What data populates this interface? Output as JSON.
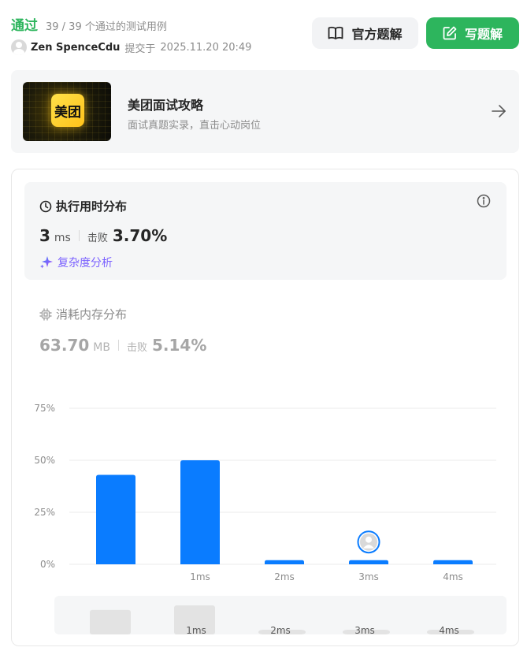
{
  "header": {
    "status": "通过",
    "case_count": "39 / 39 个通过的测试用例",
    "username": "Zen SpenceCdu",
    "submit_label": "提交于",
    "submit_time": "2025.11.20 20:49",
    "official_button": "官方题解",
    "write_button": "写题解"
  },
  "ad": {
    "logo_text": "美团",
    "title": "美团面试攻略",
    "subtitle": "面试真题实录，直击心动岗位"
  },
  "runtime": {
    "title": "执行用时分布",
    "value": "3",
    "unit": "ms",
    "beats_label": "击败",
    "beats_value": "3.70%",
    "analysis_label": "复杂度分析"
  },
  "memory": {
    "title": "消耗内存分布",
    "value": "63.70",
    "unit": "MB",
    "beats_label": "击败",
    "beats_value": "5.14%"
  },
  "colors": {
    "accent_green": "#2db55d",
    "bar_blue": "#0a7cff",
    "purple": "#7b61ff"
  },
  "chart_data": {
    "type": "bar",
    "categories": [
      "",
      "1ms",
      "2ms",
      "3ms",
      "4ms"
    ],
    "values": [
      43,
      50,
      2,
      2,
      2
    ],
    "yticks": [
      "75%",
      "50%",
      "25%",
      "0%"
    ],
    "ylim": [
      0,
      75
    ],
    "highlight_category": "3ms",
    "minimap_labels": [
      "1ms",
      "2ms",
      "3ms",
      "4ms"
    ],
    "minimap_values": [
      38,
      45,
      2,
      2,
      2
    ]
  }
}
